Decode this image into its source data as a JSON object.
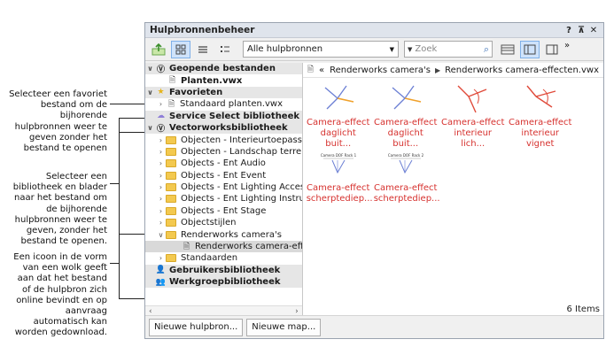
{
  "callouts": {
    "favorite": [
      "Selecteer een favoriet",
      "bestand om de",
      "bijhorende",
      "hulpbronnen weer te",
      "geven zonder het",
      "bestand te openen"
    ],
    "library": [
      "Selecteer een",
      "bibliotheek en blader",
      "naar het bestand om",
      "de bijhorende",
      "hulpbronnen weer te",
      "geven, zonder het",
      "bestand te openen."
    ],
    "cloud": [
      "Een icoon in de vorm",
      "van een wolk geeft",
      "aan dat het bestand",
      "of de hulpbron zich",
      "online bevindt en op",
      "aanvraag",
      "automatisch kan",
      "worden gedownload."
    ]
  },
  "window": {
    "title": "Hulpbronnenbeheer",
    "help": "?",
    "pin": "⊼",
    "close": "✕"
  },
  "toolbar": {
    "filter_value": "Alle hulpbronnen",
    "search_placeholder": "Zoek",
    "overflow": "»"
  },
  "tree": {
    "open_files": "Geopende bestanden",
    "open_file_1": "Planten.vwx",
    "favorites": "Favorieten",
    "favorite_1": "Standaard planten.vwx",
    "service_select": "Service Select bibliotheek",
    "vw_library": "Vectorworksbibliotheek",
    "folders": [
      "Objecten - Interieurtoepassingen",
      "Objecten - Landschap terreinaanleg",
      "Objects - Ent Audio",
      "Objects - Ent Event",
      "Objects - Ent Lighting Accessories",
      "Objects - Ent Lighting Instruments",
      "Objects - Ent Stage",
      "Objectstijlen"
    ],
    "renderworks": "Renderworks camera's",
    "renderworks_file": "Renderworks camera-effecten.vwx",
    "standaarden": "Standaarden",
    "user_lib": "Gebruikersbibliotheek",
    "workgroup_lib": "Werkgroepbibliotheek"
  },
  "breadcrumb": {
    "back": "«",
    "folder": "Renderworks camera's",
    "file": "Renderworks camera-effecten.vwx"
  },
  "items": [
    {
      "line1": "Camera-effect",
      "line2": "daglicht buit..."
    },
    {
      "line1": "Camera-effect",
      "line2": "daglicht buit..."
    },
    {
      "line1": "Camera-effect",
      "line2": "interieur lich..."
    },
    {
      "line1": "Camera-effect",
      "line2": "interieur vignet"
    },
    {
      "line1": "Camera-effect",
      "line2": "scherptediep...",
      "thumb_label": "Camera DOF Rack 1"
    },
    {
      "line1": "Camera-effect",
      "line2": "scherptediep...",
      "thumb_label": "Camera DOF Rack 2"
    }
  ],
  "status": {
    "count": "6 Items"
  },
  "footer": {
    "new_resource": "Nieuwe hulpbron...",
    "new_folder": "Nieuwe map..."
  },
  "colors": {
    "item_text": "#d6312e",
    "accent": "#7fb0e8",
    "folder": "#f3c94f"
  }
}
